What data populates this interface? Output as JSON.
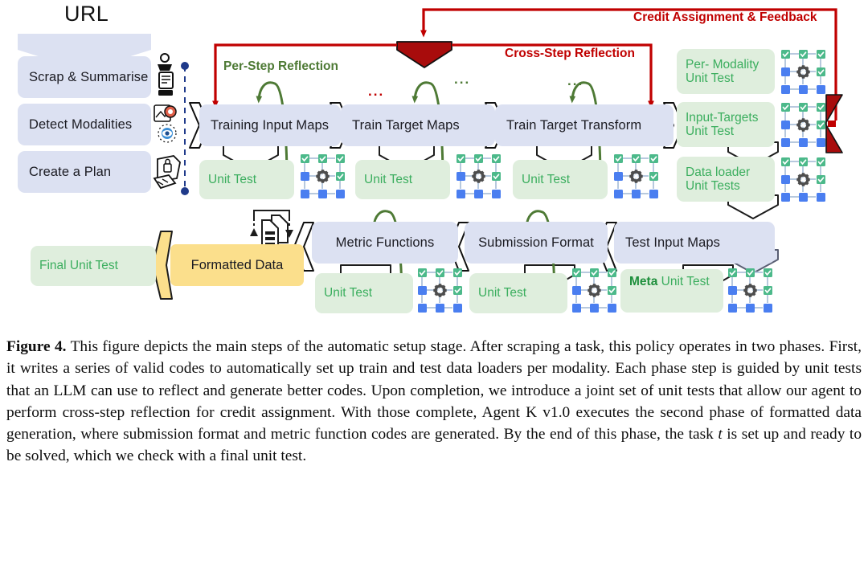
{
  "figure": {
    "label": "Figure 4.",
    "caption": "This figure depicts the main steps of the automatic setup stage. After scraping a task, this policy operates in two phases. First, it writes a series of valid codes to automatically set up train and test data loaders per modality. Each phase step is guided by unit tests that an LLM can use to reflect and generate better codes. Upon completion, we introduce a joint set of unit tests that allow our agent to perform cross-step reflection for credit assignment. With those complete, Agent K v1.0 executes the second phase of formatted data generation, where submission format and metric function codes are generated. By the end of this phase, the task ",
    "caption_italic": "t",
    "caption_tail": " is set up and ready to be solved, which we check with a final unit test."
  },
  "diagram": {
    "url_title": "URL",
    "left_steps": [
      {
        "label": "Scrap & Summarise",
        "icon": "scrape-robot-icon"
      },
      {
        "label": "Detect Modalities",
        "icon": "modality-detect-icon"
      },
      {
        "label": "Create a Plan",
        "icon": "plan-document-icon"
      }
    ],
    "annotations": {
      "credit_assignment": "Credit Assignment & Feedback",
      "cross_step_reflection": "Cross-Step Reflection",
      "per_step_reflection": "Per-Step Reflection",
      "red_ellipsis": "...",
      "green_ellipsis": "..."
    },
    "train_row": [
      {
        "step": "Training Input Maps",
        "test": "Unit Test"
      },
      {
        "step": "Train Target Maps",
        "test": "Unit Test"
      },
      {
        "step": "Train Target Transform",
        "test": "Unit Test"
      }
    ],
    "joint_tests": [
      {
        "line1": "Per- Modality",
        "line2": "Unit Test"
      },
      {
        "line1": "Input-Targets",
        "line2": "Unit Test"
      },
      {
        "line1": "Data loader",
        "line2": "Unit Tests"
      }
    ],
    "bottom_row": {
      "final_unit_test": "Final Unit Test",
      "formatted_data": "Formatted Data",
      "metric_functions": "Metric Functions",
      "metric_unit_test": "Unit Test",
      "submission_format": "Submission Format",
      "submission_unit_test": "Unit Test",
      "test_input_maps": "Test Input Maps",
      "meta_label": "Meta",
      "meta_unit_test": " Unit Test"
    },
    "colors": {
      "step_box": "#dce1f2",
      "test_box": "#dfeedd",
      "formatted_data_box": "#fbdf8c",
      "red_accent": "#c00000",
      "dark_red_shape": "#a80c0c",
      "green_accent": "#4e7a35",
      "green_text": "#3bae5e",
      "grid_green": "#4cb98a",
      "grid_blue": "#4a7ef0"
    },
    "icons": {
      "unit_test_grid": "unit-test-grid-icon",
      "data_transfer": "data-transfer-document-icon"
    }
  }
}
